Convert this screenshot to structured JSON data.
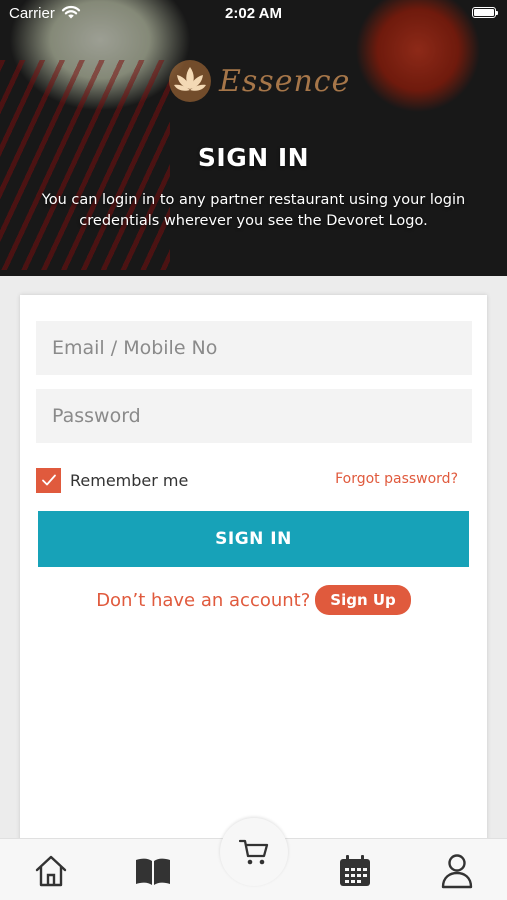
{
  "status_bar": {
    "carrier": "Carrier",
    "time": "2:02 AM"
  },
  "hero": {
    "brand": "Essence",
    "title": "SIGN IN",
    "description": "You can login in to any partner restaurant using your login credentials wherever you see the Devoret Logo."
  },
  "form": {
    "email_placeholder": "Email / Mobile No",
    "email_value": "",
    "password_placeholder": "Password",
    "password_value": "",
    "remember_label": "Remember me",
    "remember_checked": true,
    "forgot_label": "Forgot password?",
    "submit_label": "SIGN IN",
    "no_account_text": "Don’t have an account?",
    "signup_label": "Sign Up"
  },
  "tab_bar": {
    "items": [
      {
        "icon": "home-icon"
      },
      {
        "icon": "menu-book-icon"
      },
      {
        "icon": "cart-icon"
      },
      {
        "icon": "calendar-icon"
      },
      {
        "icon": "profile-icon"
      }
    ]
  },
  "colors": {
    "accent": "#e05a3d",
    "primary_button": "#17a2b8",
    "input_background": "#f3f3f3"
  }
}
